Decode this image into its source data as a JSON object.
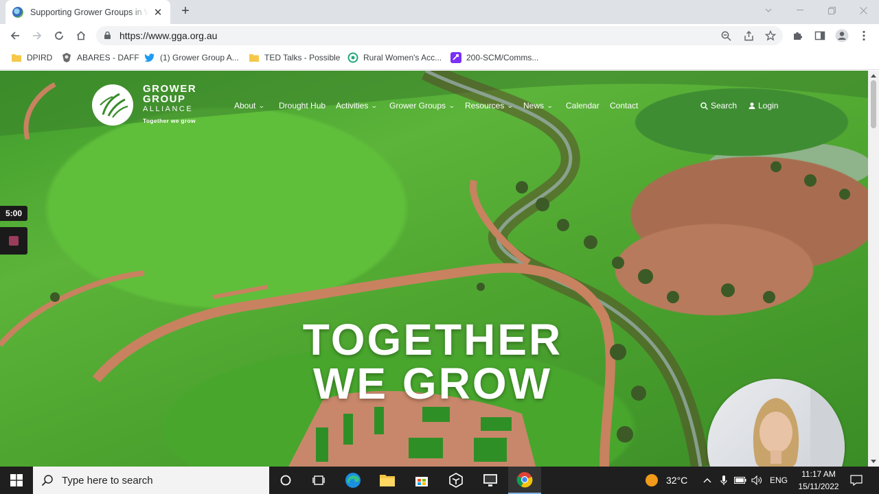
{
  "browser": {
    "tab": {
      "title": "Supporting Grower Groups in W",
      "close": "✕"
    },
    "new_tab": "+",
    "url": "https://www.gga.org.au",
    "bookmarks": [
      {
        "label": "DPIRD",
        "icon": "folder-icon"
      },
      {
        "label": "ABARES - DAFF",
        "icon": "crest-icon"
      },
      {
        "label": "(1) Grower Group A...",
        "icon": "twitter-icon"
      },
      {
        "label": "TED Talks - Possible",
        "icon": "folder-icon"
      },
      {
        "label": "Rural Women's Acc...",
        "icon": "rwa-icon"
      },
      {
        "label": "200-SCM/Comms...",
        "icon": "purple-app-icon"
      }
    ]
  },
  "site": {
    "logo": {
      "line1": "GROWER",
      "line2": "GROUP",
      "line3": "ALLIANCE",
      "tagline": "Together we grow"
    },
    "nav": [
      {
        "label": "About",
        "dropdown": true
      },
      {
        "label": "Drought Hub",
        "dropdown": false
      },
      {
        "label": "Activities",
        "dropdown": true
      },
      {
        "label": "Grower Groups",
        "dropdown": true
      },
      {
        "label": "Resources",
        "dropdown": true
      },
      {
        "label": "News",
        "dropdown": true
      },
      {
        "label": "Calendar",
        "dropdown": false
      },
      {
        "label": "Contact",
        "dropdown": false
      }
    ],
    "search_label": "Search",
    "login_label": "Login",
    "hero_line1": "TOGETHER",
    "hero_line2": "WE GROW"
  },
  "recorder": {
    "timer": "5:00"
  },
  "taskbar": {
    "search_placeholder": "Type here to search",
    "temperature": "32°C",
    "language": "ENG",
    "time": "11:17 AM",
    "date": "15/11/2022"
  },
  "colors": {
    "tabstrip": "#dee1e6",
    "taskbar": "#1f1f1f",
    "recorder_stop": "#9b3c5a"
  }
}
